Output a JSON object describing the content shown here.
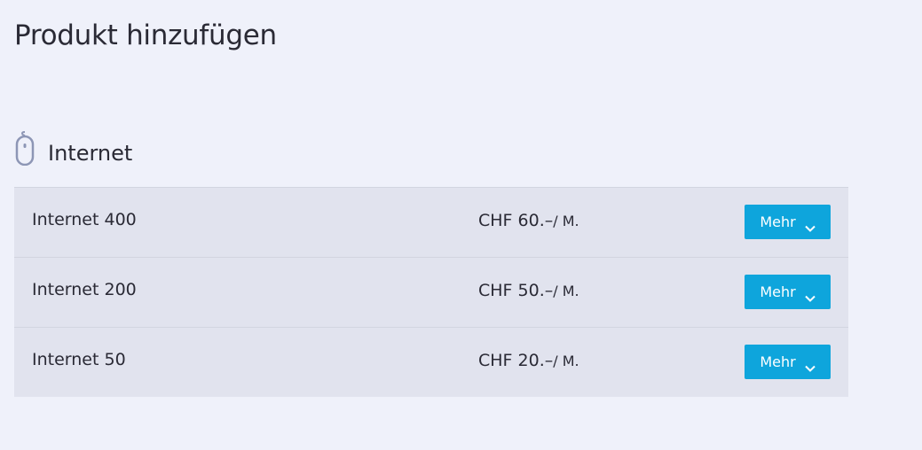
{
  "page": {
    "title": "Produkt hinzufügen"
  },
  "section": {
    "icon": "mouse-icon",
    "title": "Internet"
  },
  "products": [
    {
      "name": "Internet 400",
      "price": "CHF 60.–",
      "period": "/ M.",
      "button_label": "Mehr",
      "button_icon": "chevron-down-icon"
    },
    {
      "name": "Internet 200",
      "price": "CHF 50.–",
      "period": "/ M.",
      "button_label": "Mehr",
      "button_icon": "chevron-down-icon"
    },
    {
      "name": "Internet 50",
      "price": "CHF 20.–",
      "period": "/ M.",
      "button_label": "Mehr",
      "button_icon": "chevron-down-icon"
    }
  ],
  "colors": {
    "background": "#eff1fa",
    "row_background": "#e1e3ee",
    "accent": "#0ea5dc",
    "icon": "#8d96b5"
  }
}
